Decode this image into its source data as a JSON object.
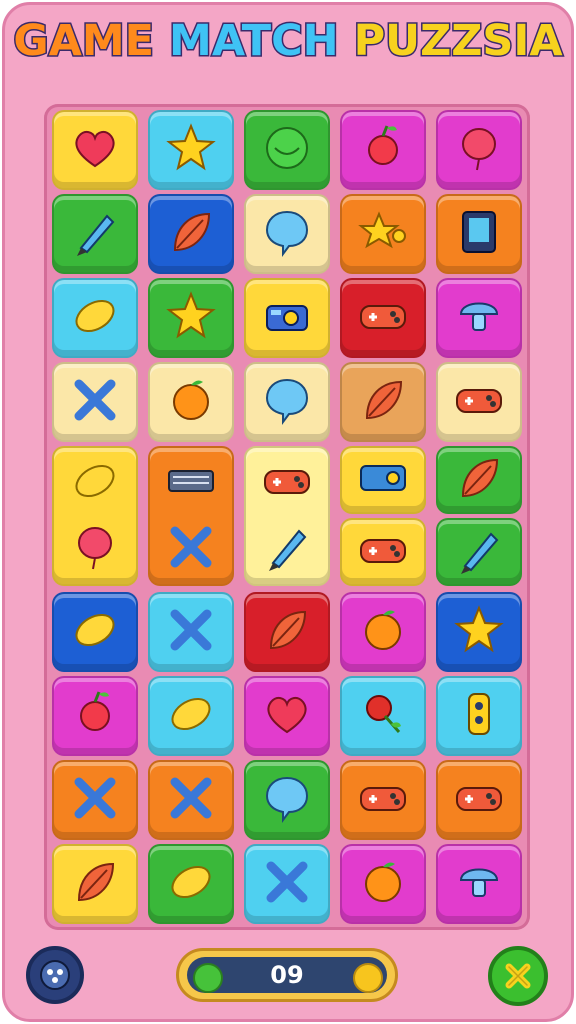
{
  "title": {
    "word1": "GAME",
    "word2": "MATCH",
    "word3": "PUZZSIA"
  },
  "colors": {
    "yellow": "#ffd83a",
    "cyan": "#4fd0f0",
    "green": "#3ab83a",
    "magenta": "#e23ccd",
    "blue": "#1d5fd4",
    "orange": "#f5821f",
    "cream": "#fbe7a8",
    "red": "#d81f2a",
    "tan": "#e9a45a",
    "lightyellow": "#fff19a"
  },
  "board": {
    "rows": [
      [
        {
          "color": "yellow",
          "icon": "heart-icon"
        },
        {
          "color": "cyan",
          "icon": "star-icon"
        },
        {
          "color": "green",
          "icon": "green-ball-icon"
        },
        {
          "color": "magenta",
          "icon": "cherry-icon"
        },
        {
          "color": "magenta",
          "icon": "balloon-icon"
        }
      ],
      [
        {
          "color": "green",
          "icon": "pencil-icon"
        },
        {
          "color": "blue",
          "icon": "leaf-icon"
        },
        {
          "color": "cream",
          "icon": "speech-bubble-icon"
        },
        {
          "color": "orange",
          "icon": "puzzle-star-icon"
        },
        {
          "color": "orange",
          "icon": "device-icon"
        }
      ],
      [
        {
          "color": "cyan",
          "icon": "lemon-icon"
        },
        {
          "color": "green",
          "icon": "star-icon"
        },
        {
          "color": "yellow",
          "icon": "camera-icon"
        },
        {
          "color": "red",
          "icon": "gamepad-icon"
        },
        {
          "color": "magenta",
          "icon": "mushroom-icon"
        }
      ],
      [
        {
          "color": "cream",
          "icon": "cross-icon"
        },
        {
          "color": "cream",
          "icon": "orange-fruit-icon"
        },
        {
          "color": "cream",
          "icon": "speech-bubble-icon"
        },
        {
          "color": "tan",
          "icon": "leaf-icon"
        },
        {
          "color": "cream",
          "icon": "gamepad-icon"
        }
      ]
    ],
    "double_rows": [
      {
        "color": "yellow",
        "icons": [
          "lemon-icon",
          "balloon-icon"
        ]
      },
      {
        "color": "orange",
        "icons": [
          "keyboard-icon",
          "cross-icon"
        ]
      },
      {
        "color": "lightyellow",
        "icons": [
          "gamepad-icon",
          "pencil-icon"
        ]
      }
    ],
    "double_split": [
      {
        "color": "yellow",
        "icons": [
          "cassette-icon",
          "gamepad-icon"
        ]
      },
      {
        "color": "green",
        "icons": [
          "leaf-icon",
          "pencil-icon"
        ]
      }
    ],
    "lower_rows": [
      [
        {
          "color": "blue",
          "icon": "lemon-icon"
        },
        {
          "color": "cyan",
          "icon": "cross-icon"
        },
        {
          "color": "red",
          "icon": "leaf-icon"
        },
        {
          "color": "magenta",
          "icon": "orange-fruit-icon"
        },
        {
          "color": "blue",
          "icon": "star-icon"
        }
      ],
      [
        {
          "color": "magenta",
          "icon": "cherry-icon"
        },
        {
          "color": "cyan",
          "icon": "lemon-icon"
        },
        {
          "color": "magenta",
          "icon": "heart-icon"
        },
        {
          "color": "cyan",
          "icon": "rose-icon"
        },
        {
          "color": "cyan",
          "icon": "switch-icon"
        }
      ],
      [
        {
          "color": "orange",
          "icon": "cross-icon"
        },
        {
          "color": "orange",
          "icon": "cross-icon"
        },
        {
          "color": "green",
          "icon": "speech-bubble-icon"
        },
        {
          "color": "orange",
          "icon": "gamepad-icon"
        },
        {
          "color": "orange",
          "icon": "gamepad-icon"
        }
      ],
      [
        {
          "color": "yellow",
          "icon": "leaf-icon"
        },
        {
          "color": "green",
          "icon": "lemon-icon"
        },
        {
          "color": "cyan",
          "icon": "cross-icon"
        },
        {
          "color": "magenta",
          "icon": "orange-fruit-icon"
        },
        {
          "color": "magenta",
          "icon": "mushroom-icon"
        }
      ]
    ]
  },
  "footer": {
    "score": "09",
    "left_button_icon": "gamepad-round-icon",
    "right_button_icon": "close-icon"
  }
}
